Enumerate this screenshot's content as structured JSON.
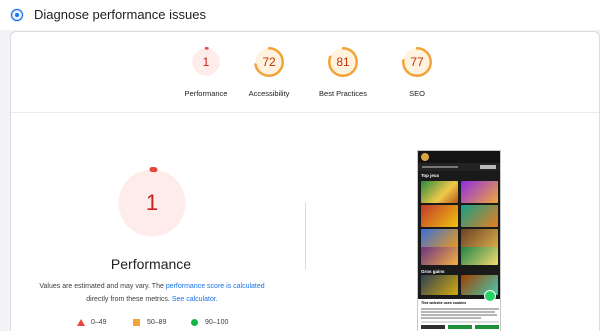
{
  "header": {
    "title": "Diagnose performance issues",
    "icon": "diagnose-icon"
  },
  "gauges": [
    {
      "score": "1",
      "label": "Performance",
      "value": 1,
      "status": "fail",
      "color": "#e8453c",
      "text_color": "#c5221f",
      "bg": "#fdecea"
    },
    {
      "score": "72",
      "label": "Accessibility",
      "value": 72,
      "status": "average",
      "color": "#f2a33a",
      "text_color": "#c33300",
      "bg": "#fff3e0"
    },
    {
      "score": "81",
      "label": "Best Practices",
      "value": 81,
      "status": "average",
      "color": "#f2a33a",
      "text_color": "#c33300",
      "bg": "#fff3e0"
    },
    {
      "score": "77",
      "label": "SEO",
      "value": 77,
      "status": "average",
      "color": "#f2a33a",
      "text_color": "#c33300",
      "bg": "#fff3e0"
    }
  ],
  "performance": {
    "score": "1",
    "value": 1,
    "title": "Performance",
    "note_prefix": "Values are estimated and may vary. The ",
    "note_link1": "performance score is calculated",
    "note_mid": " directly from these metrics. ",
    "note_link2": "See calculator.",
    "color": "#e8453c",
    "bg": "#fdecea"
  },
  "legend": [
    {
      "shape": "triangle",
      "label": "0–49",
      "color": "#e8453c"
    },
    {
      "shape": "square",
      "label": "50–89",
      "color": "#f2a33a"
    },
    {
      "shape": "circle",
      "label": "90–100",
      "color": "#12b347"
    }
  ],
  "screenshot": {
    "heading1": "Top jeux",
    "heading2": "Gros gains",
    "cookie_title": "This website uses cookies"
  }
}
